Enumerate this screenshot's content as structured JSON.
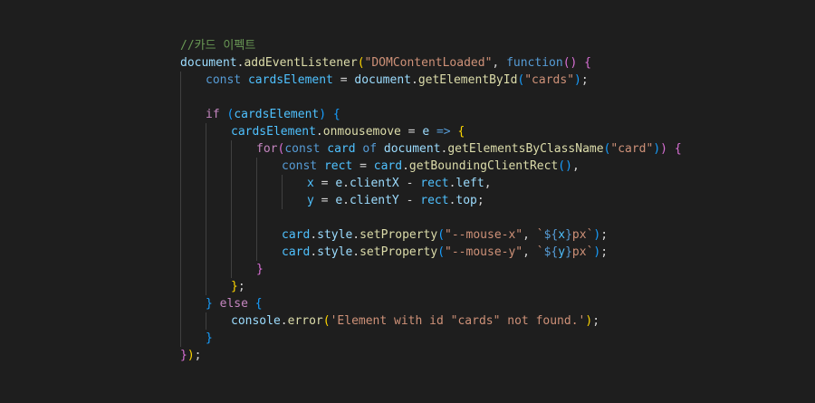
{
  "editor": {
    "theme_colors": {
      "background": "#1e1e1e",
      "comment": "#6a9955",
      "variable": "#9cdcfe",
      "function": "#dcdcaa",
      "string": "#ce9178",
      "keyword": "#569cd6",
      "control": "#c586c0",
      "bracket_level_1": "#ffd700",
      "bracket_level_2": "#da70d6",
      "bracket_level_3": "#179fff"
    },
    "lines": [
      {
        "indent": 0,
        "tokens": [
          {
            "t": "//카드 이펙트",
            "c": "comment"
          }
        ]
      },
      {
        "indent": 0,
        "tokens": [
          {
            "t": "document",
            "c": "var"
          },
          {
            "t": ".",
            "c": "text"
          },
          {
            "t": "addEventListener",
            "c": "func"
          },
          {
            "t": "(",
            "c": "b1"
          },
          {
            "t": "\"DOMContentLoaded\"",
            "c": "str"
          },
          {
            "t": ", ",
            "c": "text"
          },
          {
            "t": "function",
            "c": "kw"
          },
          {
            "t": "()",
            "c": "b2"
          },
          {
            "t": " ",
            "c": "text"
          },
          {
            "t": "{",
            "c": "b2"
          }
        ]
      },
      {
        "indent": 1,
        "tokens": [
          {
            "t": "const",
            "c": "kw"
          },
          {
            "t": " ",
            "c": "text"
          },
          {
            "t": "cardsElement",
            "c": "const"
          },
          {
            "t": " = ",
            "c": "text"
          },
          {
            "t": "document",
            "c": "var"
          },
          {
            "t": ".",
            "c": "text"
          },
          {
            "t": "getElementById",
            "c": "func"
          },
          {
            "t": "(",
            "c": "b3"
          },
          {
            "t": "\"cards\"",
            "c": "str"
          },
          {
            "t": ")",
            "c": "b3"
          },
          {
            "t": ";",
            "c": "text"
          }
        ]
      },
      {
        "indent": 1,
        "tokens": []
      },
      {
        "indent": 1,
        "tokens": [
          {
            "t": "if",
            "c": "ctrl"
          },
          {
            "t": " ",
            "c": "text"
          },
          {
            "t": "(",
            "c": "b3"
          },
          {
            "t": "cardsElement",
            "c": "const"
          },
          {
            "t": ")",
            "c": "b3"
          },
          {
            "t": " ",
            "c": "text"
          },
          {
            "t": "{",
            "c": "b3"
          }
        ]
      },
      {
        "indent": 2,
        "tokens": [
          {
            "t": "cardsElement",
            "c": "const"
          },
          {
            "t": ".",
            "c": "text"
          },
          {
            "t": "onmousemove",
            "c": "func"
          },
          {
            "t": " = ",
            "c": "text"
          },
          {
            "t": "e",
            "c": "var"
          },
          {
            "t": " ",
            "c": "text"
          },
          {
            "t": "=>",
            "c": "kw"
          },
          {
            "t": " ",
            "c": "text"
          },
          {
            "t": "{",
            "c": "b1"
          }
        ]
      },
      {
        "indent": 3,
        "tokens": [
          {
            "t": "for",
            "c": "ctrl"
          },
          {
            "t": "(",
            "c": "b2"
          },
          {
            "t": "const",
            "c": "kw"
          },
          {
            "t": " ",
            "c": "text"
          },
          {
            "t": "card",
            "c": "const"
          },
          {
            "t": " ",
            "c": "text"
          },
          {
            "t": "of",
            "c": "kw"
          },
          {
            "t": " ",
            "c": "text"
          },
          {
            "t": "document",
            "c": "var"
          },
          {
            "t": ".",
            "c": "text"
          },
          {
            "t": "getElementsByClassName",
            "c": "func"
          },
          {
            "t": "(",
            "c": "b3"
          },
          {
            "t": "\"card\"",
            "c": "str"
          },
          {
            "t": ")",
            "c": "b3"
          },
          {
            "t": ")",
            "c": "b2"
          },
          {
            "t": " ",
            "c": "text"
          },
          {
            "t": "{",
            "c": "b2"
          }
        ]
      },
      {
        "indent": 4,
        "tokens": [
          {
            "t": "const",
            "c": "kw"
          },
          {
            "t": " ",
            "c": "text"
          },
          {
            "t": "rect",
            "c": "const"
          },
          {
            "t": " = ",
            "c": "text"
          },
          {
            "t": "card",
            "c": "const"
          },
          {
            "t": ".",
            "c": "text"
          },
          {
            "t": "getBoundingClientRect",
            "c": "func"
          },
          {
            "t": "()",
            "c": "b3"
          },
          {
            "t": ",",
            "c": "text"
          }
        ]
      },
      {
        "indent": 5,
        "tokens": [
          {
            "t": "x",
            "c": "const"
          },
          {
            "t": " = ",
            "c": "text"
          },
          {
            "t": "e",
            "c": "var"
          },
          {
            "t": ".",
            "c": "text"
          },
          {
            "t": "clientX",
            "c": "var"
          },
          {
            "t": " - ",
            "c": "text"
          },
          {
            "t": "rect",
            "c": "const"
          },
          {
            "t": ".",
            "c": "text"
          },
          {
            "t": "left",
            "c": "var"
          },
          {
            "t": ",",
            "c": "text"
          }
        ]
      },
      {
        "indent": 5,
        "tokens": [
          {
            "t": "y",
            "c": "const"
          },
          {
            "t": " = ",
            "c": "text"
          },
          {
            "t": "e",
            "c": "var"
          },
          {
            "t": ".",
            "c": "text"
          },
          {
            "t": "clientY",
            "c": "var"
          },
          {
            "t": " - ",
            "c": "text"
          },
          {
            "t": "rect",
            "c": "const"
          },
          {
            "t": ".",
            "c": "text"
          },
          {
            "t": "top",
            "c": "var"
          },
          {
            "t": ";",
            "c": "text"
          }
        ]
      },
      {
        "indent": 4,
        "tokens": []
      },
      {
        "indent": 4,
        "tokens": [
          {
            "t": "card",
            "c": "const"
          },
          {
            "t": ".",
            "c": "text"
          },
          {
            "t": "style",
            "c": "var"
          },
          {
            "t": ".",
            "c": "text"
          },
          {
            "t": "setProperty",
            "c": "func"
          },
          {
            "t": "(",
            "c": "b3"
          },
          {
            "t": "\"--mouse-x\"",
            "c": "str"
          },
          {
            "t": ", ",
            "c": "text"
          },
          {
            "t": "`",
            "c": "str"
          },
          {
            "t": "${",
            "c": "kw"
          },
          {
            "t": "x",
            "c": "const"
          },
          {
            "t": "}",
            "c": "kw"
          },
          {
            "t": "px`",
            "c": "str"
          },
          {
            "t": ")",
            "c": "b3"
          },
          {
            "t": ";",
            "c": "text"
          }
        ]
      },
      {
        "indent": 4,
        "tokens": [
          {
            "t": "card",
            "c": "const"
          },
          {
            "t": ".",
            "c": "text"
          },
          {
            "t": "style",
            "c": "var"
          },
          {
            "t": ".",
            "c": "text"
          },
          {
            "t": "setProperty",
            "c": "func"
          },
          {
            "t": "(",
            "c": "b3"
          },
          {
            "t": "\"--mouse-y\"",
            "c": "str"
          },
          {
            "t": ", ",
            "c": "text"
          },
          {
            "t": "`",
            "c": "str"
          },
          {
            "t": "${",
            "c": "kw"
          },
          {
            "t": "y",
            "c": "const"
          },
          {
            "t": "}",
            "c": "kw"
          },
          {
            "t": "px`",
            "c": "str"
          },
          {
            "t": ")",
            "c": "b3"
          },
          {
            "t": ";",
            "c": "text"
          }
        ]
      },
      {
        "indent": 3,
        "tokens": [
          {
            "t": "}",
            "c": "b2"
          }
        ]
      },
      {
        "indent": 2,
        "tokens": [
          {
            "t": "}",
            "c": "b1"
          },
          {
            "t": ";",
            "c": "text"
          }
        ]
      },
      {
        "indent": 1,
        "tokens": [
          {
            "t": "}",
            "c": "b3"
          },
          {
            "t": " ",
            "c": "text"
          },
          {
            "t": "else",
            "c": "ctrl"
          },
          {
            "t": " ",
            "c": "text"
          },
          {
            "t": "{",
            "c": "b3"
          }
        ]
      },
      {
        "indent": 2,
        "tokens": [
          {
            "t": "console",
            "c": "var"
          },
          {
            "t": ".",
            "c": "text"
          },
          {
            "t": "error",
            "c": "func"
          },
          {
            "t": "(",
            "c": "b1"
          },
          {
            "t": "'Element with id \"cards\" not found.'",
            "c": "str"
          },
          {
            "t": ")",
            "c": "b1"
          },
          {
            "t": ";",
            "c": "text"
          }
        ]
      },
      {
        "indent": 1,
        "tokens": [
          {
            "t": "}",
            "c": "b3"
          }
        ]
      },
      {
        "indent": 0,
        "tokens": [
          {
            "t": "}",
            "c": "b2"
          },
          {
            "t": ")",
            "c": "b1"
          },
          {
            "t": ";",
            "c": "text"
          }
        ]
      }
    ]
  }
}
